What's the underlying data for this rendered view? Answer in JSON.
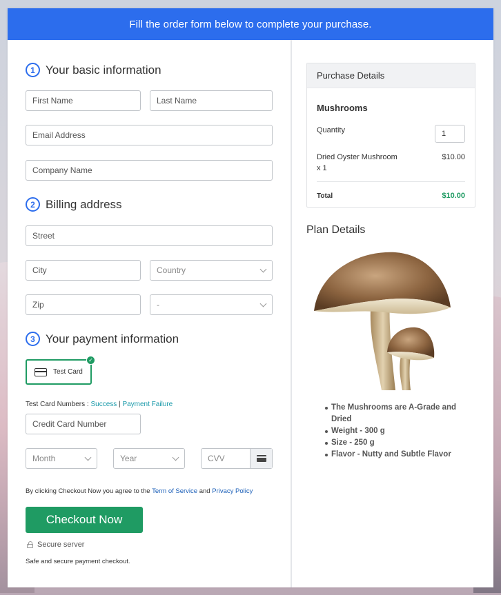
{
  "banner": "Fill the order form below to complete your purchase.",
  "sections": {
    "basic": {
      "num": "1",
      "title": "Your basic information"
    },
    "billing": {
      "num": "2",
      "title": "Billing address"
    },
    "payment": {
      "num": "3",
      "title": "Your payment information"
    }
  },
  "fields": {
    "first_name": "First Name",
    "last_name": "Last Name",
    "email": "Email Address",
    "company": "Company Name",
    "street": "Street",
    "city": "City",
    "country": "Country",
    "zip": "Zip",
    "state": "-",
    "card_number": "Credit Card Number",
    "month": "Month",
    "year": "Year",
    "cvv": "CVV"
  },
  "payment": {
    "card_label": "Test Card",
    "test_numbers_label": "Test Card Numbers : ",
    "success_link": "Success",
    "separator": " | ",
    "failure_link": "Payment Failure"
  },
  "legal": {
    "prefix": "By clicking Checkout Now you agree to the ",
    "terms": "Term of Service",
    "and": " and ",
    "privacy": "Privacy Policy"
  },
  "checkout_button": "Checkout Now",
  "secure_label": "Secure server",
  "secure_note": "Safe and secure payment checkout.",
  "purchase": {
    "header": "Purchase Details",
    "product": "Mushrooms",
    "quantity_label": "Quantity",
    "quantity_value": "1",
    "item_line1": "Dried Oyster Mushroom",
    "item_line2": "x 1",
    "item_price": "$10.00",
    "total_label": "Total",
    "total_value": "$10.00"
  },
  "plan": {
    "title": "Plan Details",
    "features": [
      "The Mushrooms are A-Grade and Dried",
      "Weight - 300 g",
      "Size - 250 g",
      "Flavor - Nutty and Subtle Flavor"
    ]
  },
  "colors": {
    "accent_blue": "#2c6ded",
    "green": "#1f9b63",
    "link_teal": "#1a9aaa"
  }
}
